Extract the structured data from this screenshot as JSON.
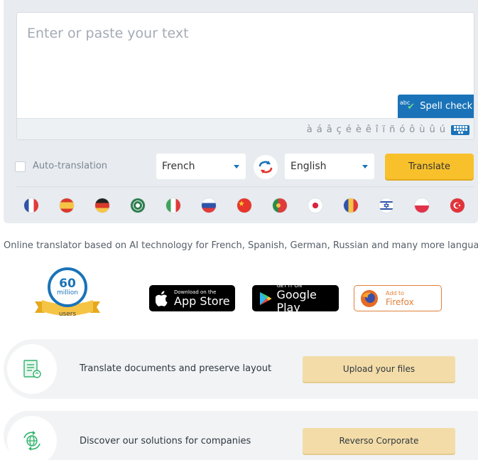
{
  "editor": {
    "placeholder": "Enter or paste your text",
    "spell_check_label": "Spell check",
    "spell_check_prefix": "abc",
    "accents": [
      "à",
      "á",
      "â",
      "ç",
      "é",
      "è",
      "ê",
      "î",
      "ï",
      "ñ",
      "ó",
      "ô",
      "ù",
      "û",
      "ú"
    ]
  },
  "controls": {
    "auto_translation_label": "Auto-translation",
    "auto_translation_checked": false,
    "source_language": "French",
    "target_language": "English",
    "translate_label": "Translate"
  },
  "flags": [
    "french-flag",
    "spanish-flag",
    "german-flag",
    "arabic-flag",
    "italian-flag",
    "russian-flag",
    "chinese-flag",
    "portuguese-flag",
    "japanese-flag",
    "romanian-flag",
    "hebrew-flag",
    "polish-flag",
    "turkish-flag"
  ],
  "tagline": "Online translator based on AI technology for French, Spanish, German, Russian and many more languages",
  "badge": {
    "number": "60",
    "unit": "million",
    "label": "users"
  },
  "stores": {
    "appstore": {
      "small": "Download on the",
      "big": "App Store"
    },
    "googleplay": {
      "small": "GET IT ON",
      "big": "Google Play"
    },
    "firefox": {
      "small": "Add to",
      "big": "Firefox"
    }
  },
  "features": [
    {
      "text": "Translate documents and preserve layout",
      "button": "Upload your files"
    },
    {
      "text": "Discover our solutions for companies",
      "button": "Reverso Corporate"
    }
  ],
  "colors": {
    "accent_blue": "#1a73b8",
    "translate_yellow": "#f8c12c",
    "feature_button": "#f3dca7",
    "panel_bg": "#e8ecf0"
  }
}
